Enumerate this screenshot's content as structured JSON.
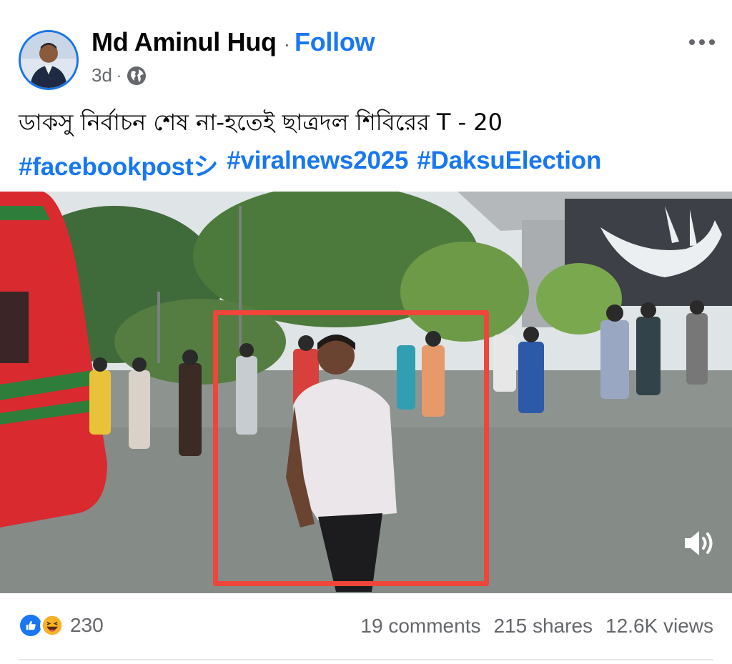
{
  "post": {
    "author": "Md Aminul Huq",
    "separator": "·",
    "follow_label": "Follow",
    "time": "3d",
    "time_separator": "·",
    "privacy_icon": "globe-icon",
    "more_icon": "more-options-icon",
    "text": "ডাকসু নির্বাচন শেষ না-হতেই ছাত্রদল শিবিরের  T - 20",
    "hashtags": [
      "#facebookpostシ",
      "#viralnews2025",
      "#DaksuElection"
    ]
  },
  "media": {
    "type": "video",
    "highlight_color": "#f0453a",
    "volume_icon": "volume-icon"
  },
  "stats": {
    "reaction_icons": [
      "like-icon",
      "haha-icon"
    ],
    "reactions": "230",
    "comments": "19 comments",
    "shares": "215 shares",
    "views": "12.6K views"
  },
  "colors": {
    "accent": "#1877f2",
    "text": "#050505",
    "muted": "#65676b"
  }
}
